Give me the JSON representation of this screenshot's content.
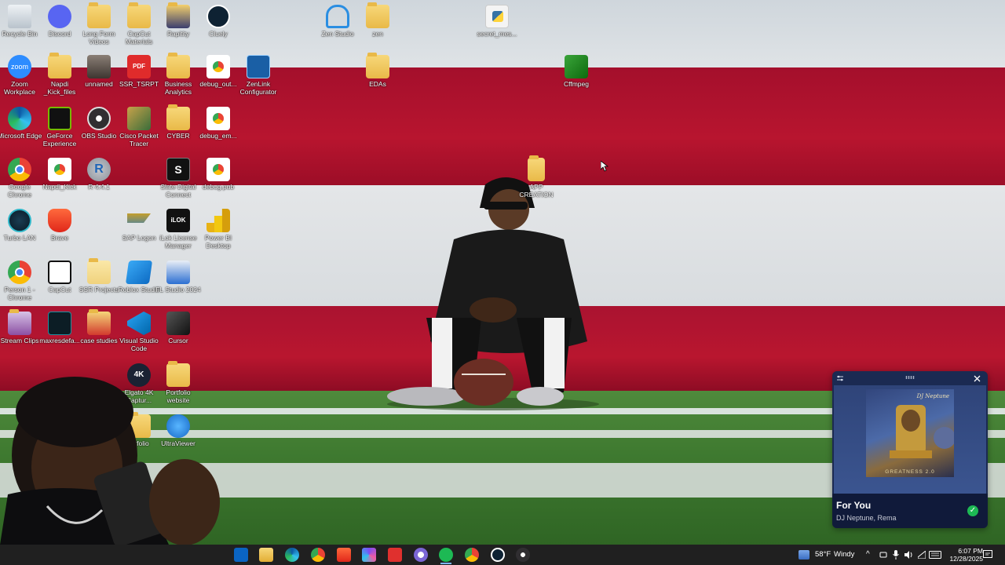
{
  "desktop": {
    "icons": [
      {
        "label": "Recycle Bin"
      },
      {
        "label": "Discord"
      },
      {
        "label": "Long Form Videos"
      },
      {
        "label": "CapCut Materials"
      },
      {
        "label": "Rapitity"
      },
      {
        "label": "Cluely"
      },
      {
        "label": "Zen Studio"
      },
      {
        "label": "zen"
      },
      {
        "label": "secret_mes..."
      },
      {
        "label": "Zoom Workplace"
      },
      {
        "label": "Napdi _Kick_files"
      },
      {
        "label": "unnamed"
      },
      {
        "label": "SSR_TSRPT"
      },
      {
        "label": "Business Analytics"
      },
      {
        "label": "debug_out..."
      },
      {
        "label": "ZenLink Configurator"
      },
      {
        "label": "EDAs"
      },
      {
        "label": "Cffmpeg"
      },
      {
        "label": "Microsoft Edge"
      },
      {
        "label": "GeForce Experience"
      },
      {
        "label": "OBS Studio"
      },
      {
        "label": "Cisco Packet Tracer"
      },
      {
        "label": "CYBER"
      },
      {
        "label": "debug_em..."
      },
      {
        "label": "Google Chrome"
      },
      {
        "label": "Napdi_Kick"
      },
      {
        "label": "R 4.4.1"
      },
      {
        "label": "Slate Digital Connect"
      },
      {
        "label": "debug.pub"
      },
      {
        "label": "APP CREATION"
      },
      {
        "label": "Turbo LAN"
      },
      {
        "label": "Brave"
      },
      {
        "label": "SAP Logon"
      },
      {
        "label": "iLok License Manager"
      },
      {
        "label": "Power BI Desktop"
      },
      {
        "label": "Person 1 - Chrome"
      },
      {
        "label": "CapCut"
      },
      {
        "label": "SSR Projects"
      },
      {
        "label": "Roblox Studio"
      },
      {
        "label": "FL Studio 2024"
      },
      {
        "label": "Stream Clips"
      },
      {
        "label": "maxresdefa..."
      },
      {
        "label": "case studies"
      },
      {
        "label": "Visual Studio Code"
      },
      {
        "label": "Cursor"
      },
      {
        "label": "Elgato 4K Captur..."
      },
      {
        "label": "Portfolio website"
      },
      {
        "label": "ortfolio"
      },
      {
        "label": "UltraViewer"
      }
    ]
  },
  "media": {
    "title": "For You",
    "artist": "DJ Neptune, Rema",
    "album_text": "GREATNESS 2.0",
    "album_script": "DJ Neptune",
    "check": "✓"
  },
  "taskbar": {
    "weather_temp": "58°F",
    "weather_desc": "Windy",
    "chevron": "^",
    "time": "6:07 PM",
    "date": "12/28/2025"
  },
  "colors": {
    "red_band": "#b0122f",
    "taskbar": "#202020",
    "media_bg": "#1b2a52",
    "accent_green": "#1db954"
  }
}
